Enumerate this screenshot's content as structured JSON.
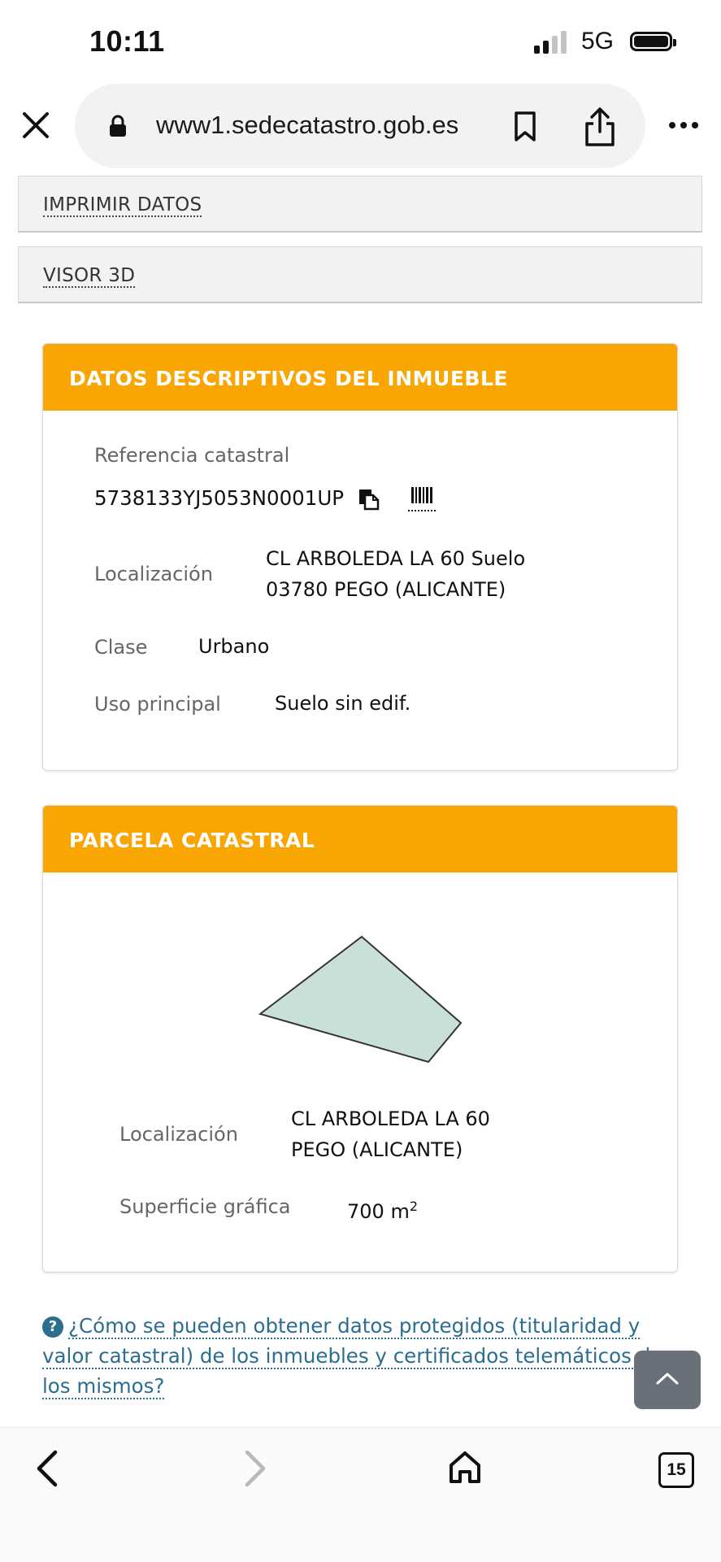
{
  "status": {
    "time": "10:11",
    "network": "5G"
  },
  "browser": {
    "url": "www1.sedecatastro.gob.es"
  },
  "actions": {
    "print": "IMPRIMIR DATOS",
    "viewer3d": "VISOR 3D"
  },
  "descriptive": {
    "title": "DATOS DESCRIPTIVOS DEL INMUEBLE",
    "ref_label": "Referencia catastral",
    "ref_value": "5738133YJ5053N0001UP",
    "loc_label": "Localización",
    "loc_line1": "CL ARBOLEDA LA 60 Suelo",
    "loc_line2": "03780 PEGO (ALICANTE)",
    "class_label": "Clase",
    "class_value": "Urbano",
    "use_label": "Uso principal",
    "use_value": "Suelo sin edif."
  },
  "parcel": {
    "title": "PARCELA CATASTRAL",
    "loc_label": "Localización",
    "loc_line1": "CL ARBOLEDA LA 60",
    "loc_line2": "PEGO (ALICANTE)",
    "surface_label": "Superficie gráfica",
    "surface_value": "700 m",
    "surface_exp": "2",
    "shape_fill": "#c8e0d6"
  },
  "help": {
    "text": "¿Cómo se pueden obtener datos protegidos (titularidad y valor catastral) de los inmuebles y certificados telemáticos de los mismos?"
  },
  "nav": {
    "tab_count": "15"
  },
  "colors": {
    "accent": "#f9a602",
    "link": "#2c6e8e"
  }
}
